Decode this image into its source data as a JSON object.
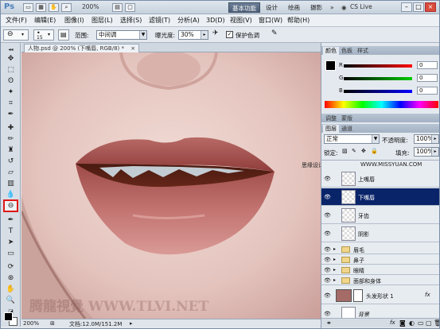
{
  "titlebar": {
    "app_logo": "Ps",
    "zoom_display": "200%",
    "workspaces": [
      "基本功能",
      "设计",
      "绘画",
      "摄影"
    ],
    "more": "»",
    "cs_live": "CS Live"
  },
  "menu": [
    "文件(F)",
    "编辑(E)",
    "图像(I)",
    "图层(L)",
    "选择(S)",
    "滤镜(T)",
    "分析(A)",
    "3D(D)",
    "视图(V)",
    "窗口(W)",
    "帮助(H)"
  ],
  "options": {
    "brush_size": "15",
    "range_label": "范围:",
    "range_value": "中间调",
    "exposure_label": "曝光度:",
    "exposure_value": "30%",
    "protect_label": "保护色调",
    "protect_checked": "✓"
  },
  "document": {
    "tab": "人物.psd @ 200% (下嘴唇, RGB/8) *",
    "zoom": "200%",
    "doc_info": "文档:12.0M/151.2M",
    "watermark_left": "思缘设计论坛",
    "watermark_right": "WWW.MISSYUAN.COM",
    "watermark_bottom": "腾龍視覺 WWW.TLVI.NET"
  },
  "color_panel": {
    "tabs": [
      "颜色",
      "色板",
      "样式"
    ],
    "r_label": "R",
    "g_label": "G",
    "b_label": "B",
    "r": "0",
    "g": "0",
    "b": "0"
  },
  "adjust_panel": {
    "tabs": [
      "调整",
      "蒙版"
    ]
  },
  "layers_panel": {
    "tabs": [
      "图层",
      "通道"
    ],
    "blend_mode": "正常",
    "opacity_label": "不透明度:",
    "opacity": "100%",
    "lock_label": "锁定:",
    "fill_label": "填充:",
    "fill": "100%",
    "layers": [
      {
        "name": "上嘴唇",
        "selected": false
      },
      {
        "name": "下嘴唇",
        "selected": true
      },
      {
        "name": "牙齿",
        "selected": false
      },
      {
        "name": "阴影",
        "selected": false
      }
    ],
    "groups": [
      "眉毛",
      "鼻子",
      "眼睛",
      "面部和身体"
    ],
    "shape_layer": "头发形状 1",
    "fx": "fx",
    "background_layer": "背景"
  },
  "colors": {
    "accent_selected": "#0a246a",
    "highlight_border": "#e01818",
    "lip": "#b25b58"
  }
}
